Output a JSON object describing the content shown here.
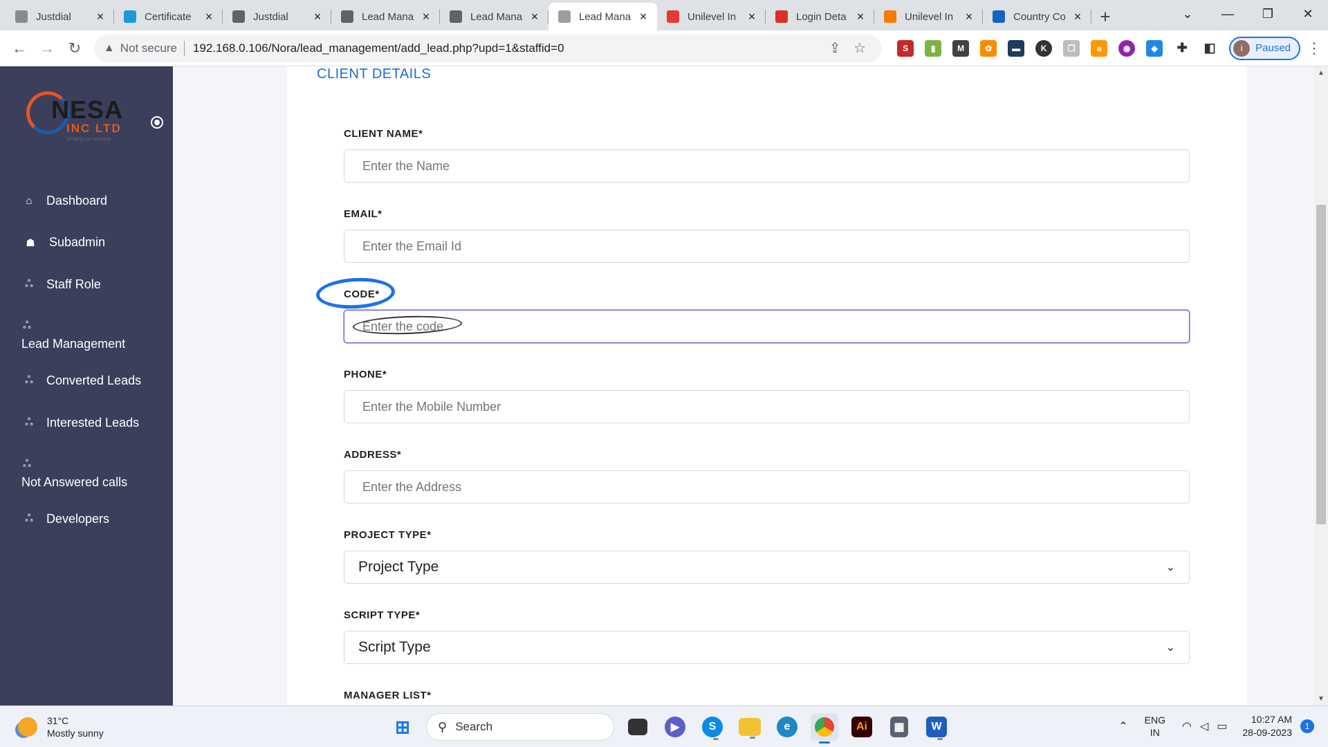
{
  "browser": {
    "tabs": [
      {
        "title": "Justdial",
        "fav_color": "#8a8a8a"
      },
      {
        "title": "Certificate",
        "fav_color": "#1a9bd7"
      },
      {
        "title": "Justdial",
        "fav_color": "#5f6368"
      },
      {
        "title": "Lead Mana",
        "fav_color": "#5f6368"
      },
      {
        "title": "Lead Mana",
        "fav_color": "#5f6368"
      },
      {
        "title": "Lead Mana",
        "fav_color": "#9e9e9e",
        "active": true
      },
      {
        "title": "Unilevel In",
        "fav_color": "#e53935"
      },
      {
        "title": "Login Deta",
        "fav_color": "#d93025"
      },
      {
        "title": "Unilevel In",
        "fav_color": "#f57c00"
      },
      {
        "title": "Country Co",
        "fav_color": "#1565c0"
      }
    ],
    "new_tab": "+",
    "security_label": "Not secure",
    "url": "192.168.0.106/Nora/lead_management/add_lead.php?upd=1&staffid=0",
    "profile": {
      "initial": "i",
      "label": "Paused"
    }
  },
  "sidebar": {
    "logo": {
      "name": "NESA",
      "sub": "INC LTD",
      "tagline": "bringing our success"
    },
    "items": [
      {
        "label": "Dashboard",
        "icon": "home-icon"
      },
      {
        "label": "Subadmin",
        "icon": "users-icon"
      },
      {
        "label": "Staff Role",
        "icon": "org-icon"
      },
      {
        "label": "Lead Management",
        "icon": "org-icon"
      },
      {
        "label": "Converted Leads",
        "icon": "org-icon"
      },
      {
        "label": "Interested Leads",
        "icon": "org-icon"
      },
      {
        "label": "Not Answered calls",
        "icon": "org-icon"
      },
      {
        "label": "Developers",
        "icon": "org-icon"
      }
    ]
  },
  "form": {
    "section_title": "CLIENT DETAILS",
    "client_name": {
      "label": "CLIENT NAME*",
      "placeholder": "Enter the Name"
    },
    "email": {
      "label": "EMAIL*",
      "placeholder": "Enter the Email Id"
    },
    "code": {
      "label": "CODE*",
      "placeholder": "Enter the code"
    },
    "phone": {
      "label": "PHONE*",
      "placeholder": "Enter the Mobile Number"
    },
    "address": {
      "label": "ADDRESS*",
      "placeholder": "Enter the Address"
    },
    "project_type": {
      "label": "PROJECT TYPE*",
      "value": "Project Type"
    },
    "script_type": {
      "label": "SCRIPT TYPE*",
      "value": "Script Type"
    },
    "manager_list": {
      "label": "MANAGER LIST*"
    }
  },
  "taskbar": {
    "weather": {
      "temp": "31°C",
      "desc": "Mostly sunny"
    },
    "search_label": "Search",
    "lang": {
      "line1": "ENG",
      "line2": "IN"
    },
    "time": "10:27 AM",
    "date": "28-09-2023",
    "notifications": "1"
  }
}
